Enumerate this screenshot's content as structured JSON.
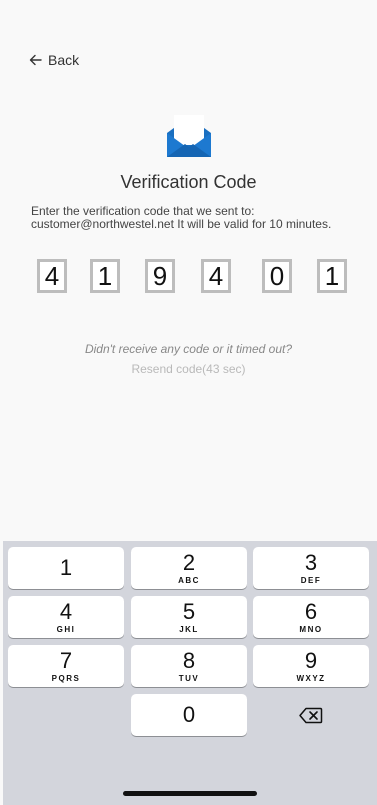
{
  "header": {
    "back_label": "Back"
  },
  "main": {
    "title": "Verification Code",
    "description": "Enter the verification code that we sent to: customer@northwestel.net It will be valid for 10 minutes.",
    "code_digits": [
      "4",
      "1",
      "9",
      "4",
      "0",
      "1"
    ],
    "timeout_text": "Didn't receive any code or it timed out?",
    "resend_text": "Resend code(43 sec)"
  },
  "keypad": {
    "keys": [
      {
        "num": "1",
        "letters": ""
      },
      {
        "num": "2",
        "letters": "ABC"
      },
      {
        "num": "3",
        "letters": "DEF"
      },
      {
        "num": "4",
        "letters": "GHI"
      },
      {
        "num": "5",
        "letters": "JKL"
      },
      {
        "num": "6",
        "letters": "MNO"
      },
      {
        "num": "7",
        "letters": "PQRS"
      },
      {
        "num": "8",
        "letters": "TUV"
      },
      {
        "num": "9",
        "letters": "WXYZ"
      },
      {
        "num": "0",
        "letters": ""
      }
    ]
  },
  "icons": {
    "back": "arrow-left-icon",
    "envelope": "envelope-open-icon",
    "delete": "backspace-icon"
  },
  "colors": {
    "envelope_blue": "#1a6fc0",
    "keyboard_bg": "#d3d5dc",
    "digit_box": "#c4c4c4"
  }
}
